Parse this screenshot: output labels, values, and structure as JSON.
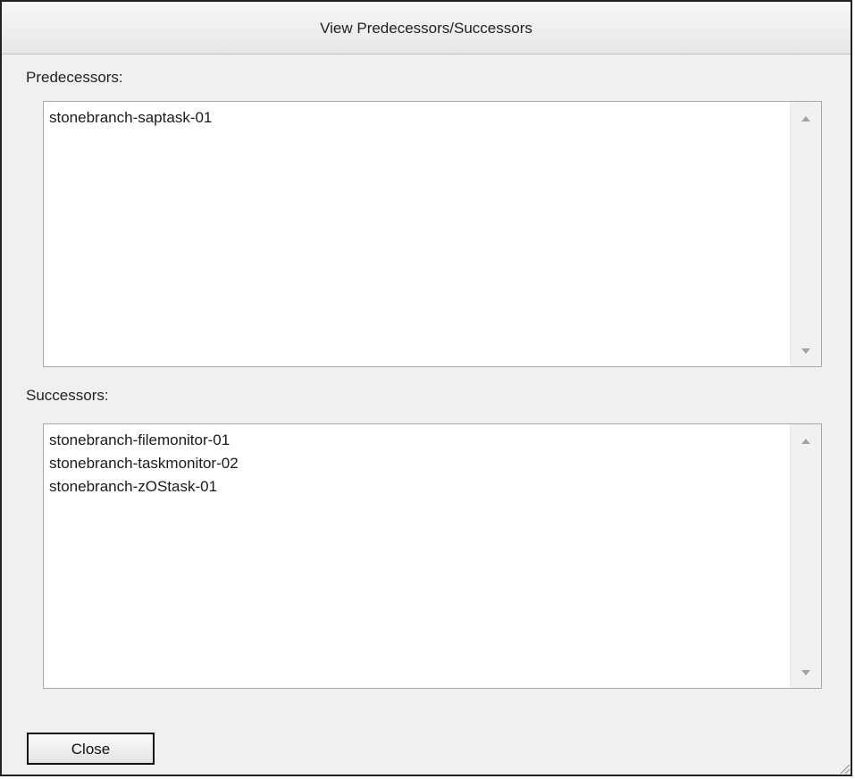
{
  "dialog": {
    "title": "View Predecessors/Successors"
  },
  "predecessors": {
    "label": "Predecessors:",
    "items": [
      "stonebranch-saptask-01"
    ]
  },
  "successors": {
    "label": "Successors:",
    "items": [
      "stonebranch-filemonitor-01",
      "stonebranch-taskmonitor-02",
      "stonebranch-zOStask-01"
    ]
  },
  "footer": {
    "close_label": "Close"
  },
  "icons": {
    "scroll_up": "scroll-up-arrow-icon",
    "scroll_down": "scroll-down-arrow-icon",
    "resize": "resize-grip-icon"
  }
}
